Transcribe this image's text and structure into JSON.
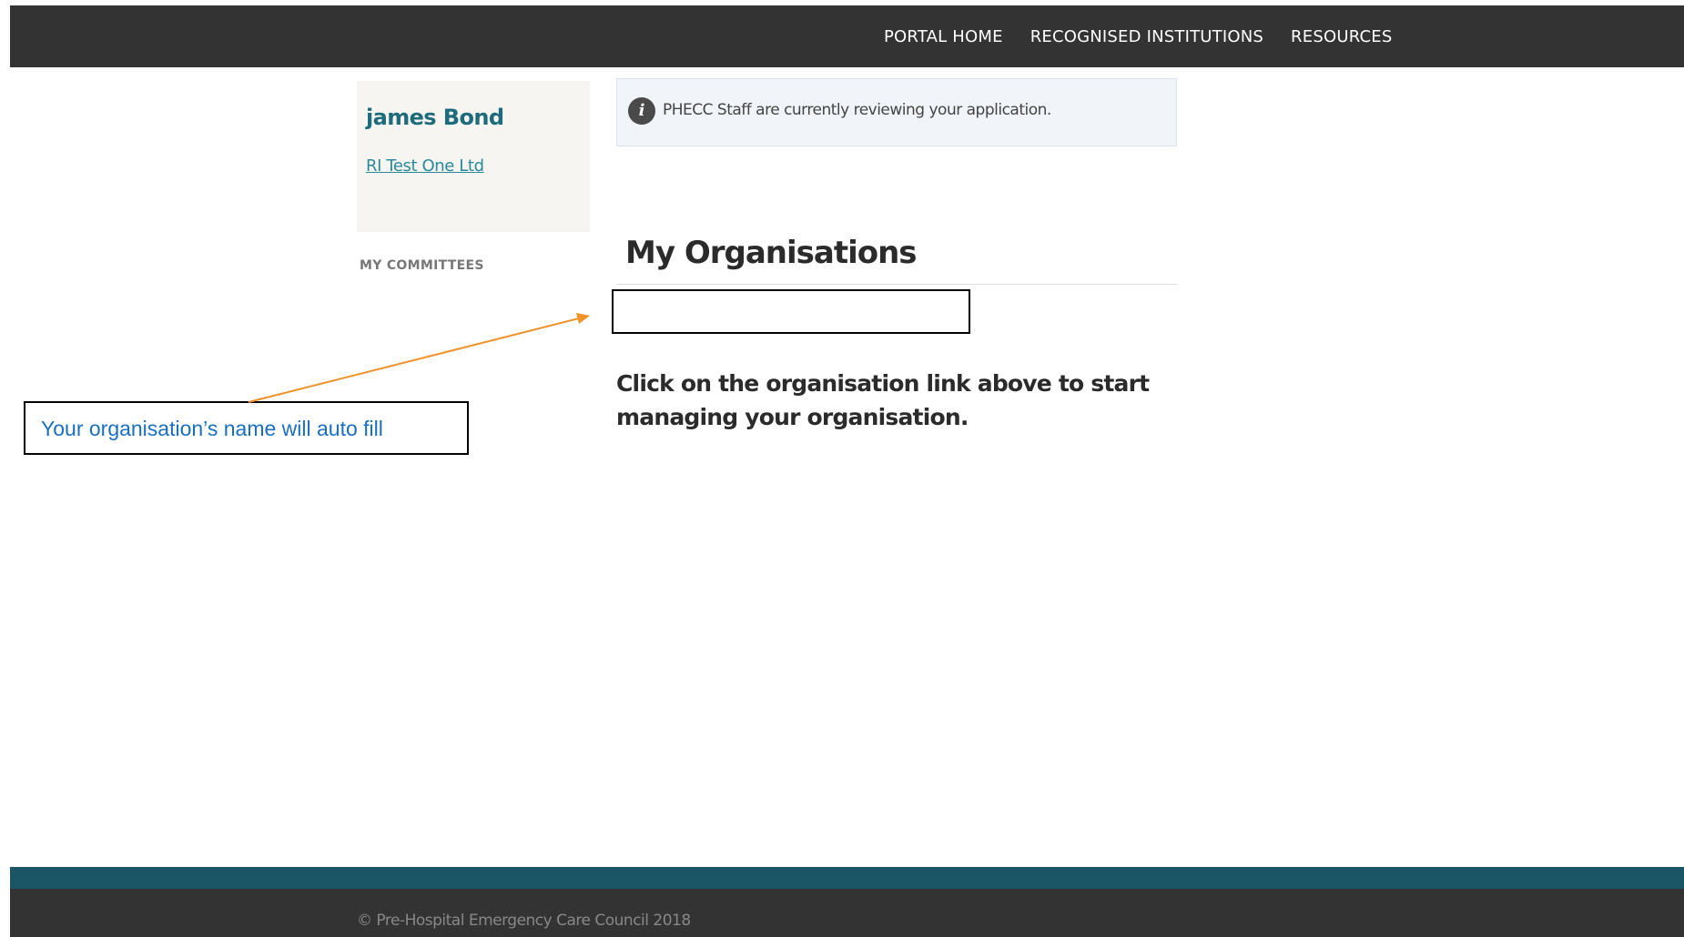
{
  "topnav": {
    "items": [
      "PORTAL HOME",
      "RECOGNISED INSTITUTIONS",
      "RESOURCES"
    ]
  },
  "sidebar": {
    "user_name": "james Bond",
    "org_link": "RI Test One Ltd",
    "committees_heading": "MY COMMITTEES"
  },
  "alert": {
    "icon": "info-icon",
    "text": "PHECC Staff are currently reviewing your application."
  },
  "main": {
    "title": "My Organisations",
    "instructions": "Click on the organisation link above to start managing your organisation."
  },
  "annotation": {
    "callout_text": "Your organisation’s name will auto fill",
    "arrow_color": "#f0922a",
    "text_color": "#1a6fc0"
  },
  "footer": {
    "copyright": "© Pre-Hospital Emergency Care Council  2018"
  },
  "colors": {
    "topbar": "#333333",
    "teal_band": "#1a5666",
    "accent": "#1e6b7b"
  }
}
